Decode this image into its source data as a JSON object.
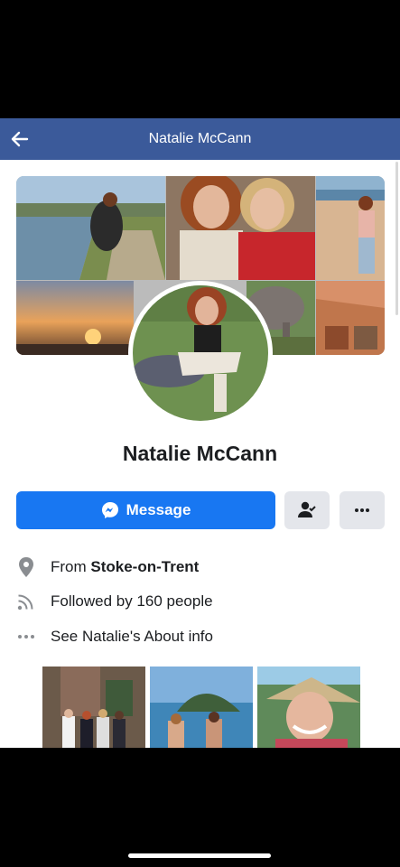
{
  "header": {
    "title": "Natalie McCann",
    "back_icon": "arrow-left-icon",
    "color": "#3b5a9a"
  },
  "profile": {
    "name": "Natalie McCann"
  },
  "actions": {
    "message_label": "Message",
    "message_icon": "messenger-icon",
    "friend_icon": "add-friend-icon",
    "more_icon": "more-icon",
    "accent": "#1877f2"
  },
  "info": {
    "from_prefix": "From ",
    "from_place": "Stoke-on-Trent",
    "followed_by": "Followed by 160 people",
    "about": "See Natalie's About info"
  }
}
